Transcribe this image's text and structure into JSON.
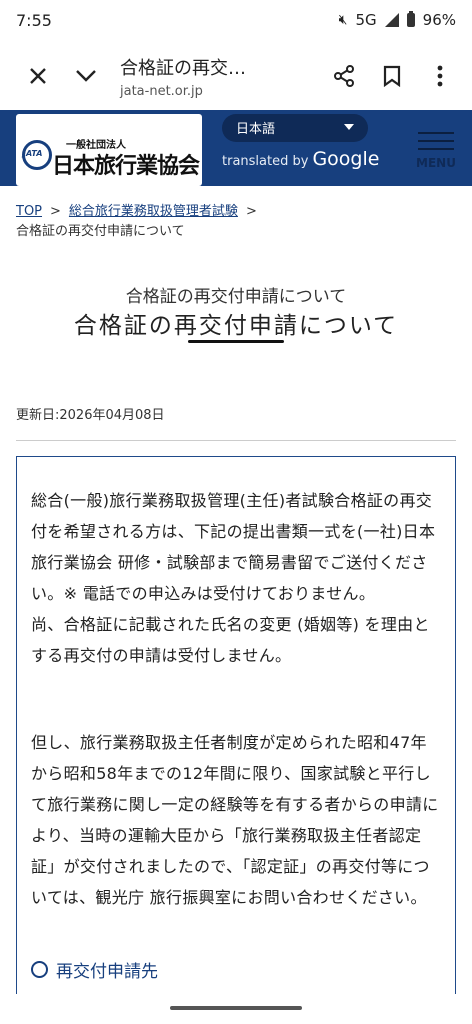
{
  "status": {
    "time": "7:55",
    "network": "5G",
    "battery": "96%"
  },
  "toolbar": {
    "title": "合格証の再交…",
    "url": "jata-net.or.jp",
    "close_icon": "close-icon",
    "menu_icon": "more-vert-icon"
  },
  "site": {
    "logo_sub": "一般社団法人",
    "logo_main": "日本旅行業協会",
    "language": "日本語",
    "translated_prefix": "translated by",
    "translated_brand": "Google",
    "menu_label": "MENU"
  },
  "breadcrumb": {
    "home": "TOP",
    "separator": ">",
    "parent": "総合旅行業務取扱管理者試験",
    "current": "合格証の再交付申請について"
  },
  "page": {
    "subtitle": "合格証の再交付申請について",
    "title": "合格証の再交付申請について",
    "updated": "更新日:2026年04月08日"
  },
  "content": {
    "paragraph1": "総合(一般)旅行業務取扱管理(主任)者試験合格証の再交付を希望される方は、下記の提出書類一式を(一社)日本旅行業協会 研修・試験部まで簡易書留でご送付ください。※ 電話での申込みは受付けておりません。\n尚、合格証に記載された氏名の変更 (婚姻等) を理由とする再交付の申請は受付しません。",
    "paragraph2": "但し、旅行業務取扱主任者制度が定められた昭和47年から昭和58年までの12年間に限り、国家試験と平行して旅行業務に関し一定の経験等を有する者からの申請により、当時の運輸大臣から「旅行業務取扱主任者認定証」が交付されましたので、「認定証」の再交付等については、観光庁 旅行振興室にお問い合わせください。",
    "section_heading": "再交付申請先"
  }
}
